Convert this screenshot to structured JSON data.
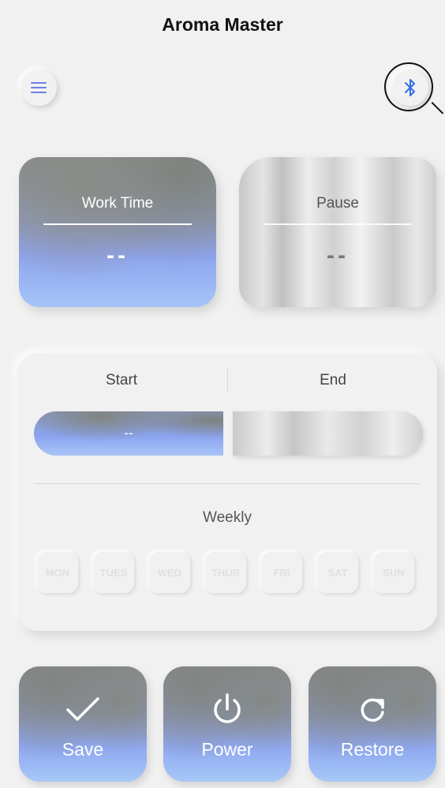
{
  "app": {
    "title": "Aroma Master"
  },
  "header": {
    "menu_icon": "hamburger-menu-icon",
    "bluetooth_icon": "bluetooth-icon"
  },
  "colors": {
    "accent_blue": "#8ea4ee",
    "background": "#f1f1f1",
    "bluetooth": "#2f6fe6"
  },
  "work_time": {
    "label": "Work Time",
    "value": "--"
  },
  "pause": {
    "label": "Pause",
    "value": "--"
  },
  "schedule": {
    "start_label": "Start",
    "end_label": "End",
    "start_value": "--",
    "end_value": "--",
    "weekly_label": "Weekly",
    "days": [
      "MON",
      "TUES",
      "WED",
      "THUR",
      "FRI",
      "SAT",
      "SUN"
    ]
  },
  "actions": {
    "save": {
      "label": "Save",
      "icon": "checkmark-icon"
    },
    "power": {
      "label": "Power",
      "icon": "power-icon"
    },
    "restore": {
      "label": "Restore",
      "icon": "restore-icon"
    }
  }
}
